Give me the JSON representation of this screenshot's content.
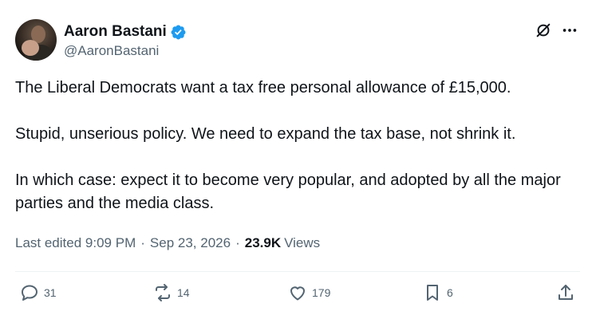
{
  "author": {
    "name": "Aaron Bastani",
    "handle": "@AaronBastani"
  },
  "tweet": {
    "paragraphs": [
      "The Liberal Democrats want a tax free personal allowance of £15,000.",
      "Stupid, unserious policy. We need to expand the tax base, not shrink it.",
      "In which case: expect it to become very popular, and adopted by all the major parties and the media class."
    ],
    "edited_label": "Last edited",
    "time": "9:09 PM",
    "date": "Sep 23, 2026",
    "separator": "·",
    "views_count": "23.9K",
    "views_label": "Views"
  },
  "actions": {
    "replies": "31",
    "reposts": "14",
    "likes": "179",
    "bookmarks": "6"
  },
  "colors": {
    "verified": "#1d9bf0",
    "muted": "#536471",
    "text": "#0f1419"
  },
  "icons": [
    "verified-badge-icon",
    "grok-icon",
    "more-icon",
    "reply-icon",
    "repost-icon",
    "like-icon",
    "bookmark-icon",
    "share-icon"
  ]
}
